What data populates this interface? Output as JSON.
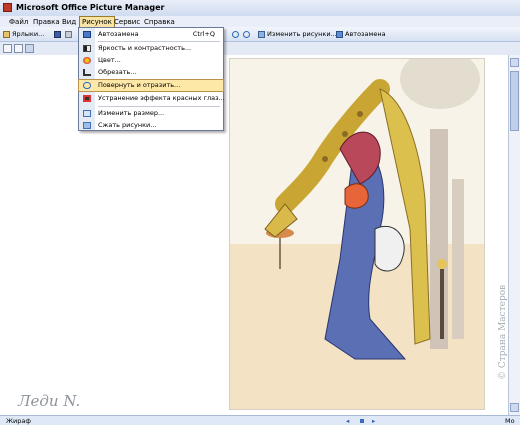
{
  "window": {
    "title": "Microsoft Office Picture Manager"
  },
  "menubar": {
    "items": [
      "Файл",
      "Правка",
      "Вид",
      "Рисунок",
      "Сервис",
      "Справка"
    ]
  },
  "toolbar": {
    "shortcuts_label": "Ярлыки...",
    "edit_pictures_label": "Изменить рисунки...",
    "autocorrect_label": "Автозамена"
  },
  "picture_menu": {
    "items": [
      {
        "label": "Автозамена",
        "shortcut": "Ctrl+Q",
        "icon": "autocorrect-icon"
      },
      {
        "label": "Яркость и контрастность...",
        "icon": "brightness-icon"
      },
      {
        "label": "Цвет...",
        "icon": "color-icon"
      },
      {
        "label": "Обрезать...",
        "icon": "crop-icon"
      },
      {
        "label": "Повернуть и отразить...",
        "icon": "rotate-icon",
        "highlighted": true
      },
      {
        "label": "Устранение эффекта красных глаз...",
        "icon": "red-eye-icon"
      },
      {
        "label": "Изменить размер...",
        "icon": "resize-icon"
      },
      {
        "label": "Сжать рисунки...",
        "icon": "compress-icon"
      }
    ]
  },
  "overlay": {
    "signature": "Леди N.",
    "watermark": "© Страна Мастеров"
  },
  "statusbar": {
    "filename": "Жираф",
    "right_text": "Мо"
  },
  "colors": {
    "menu_highlight": "#fde8a8",
    "chrome": "#dfe8f6"
  }
}
